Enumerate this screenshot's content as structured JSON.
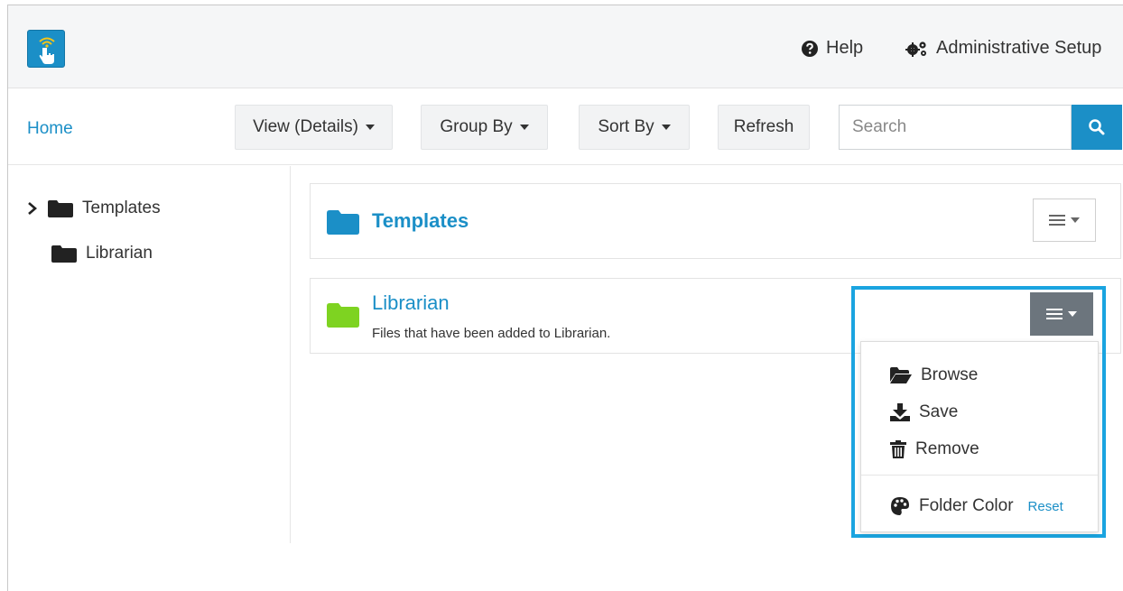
{
  "header": {
    "help_label": "Help",
    "admin_label": "Administrative Setup"
  },
  "toolbar": {
    "home_label": "Home",
    "view_label": "View (Details)",
    "group_label": "Group By",
    "sort_label": "Sort By",
    "refresh_label": "Refresh",
    "search_placeholder": "Search"
  },
  "sidebar": {
    "items": [
      {
        "label": "Templates",
        "expandable": true
      },
      {
        "label": "Librarian",
        "expandable": false
      }
    ]
  },
  "folders": [
    {
      "title": "Templates",
      "description": "",
      "color": "#1b8fc7"
    },
    {
      "title": "Librarian",
      "description": "Files that have been added to Librarian.",
      "color": "#7ed321"
    }
  ],
  "menu": {
    "browse_label": "Browse",
    "save_label": "Save",
    "remove_label": "Remove",
    "folder_color_label": "Folder Color",
    "reset_label": "Reset"
  },
  "colors": {
    "accent": "#1b8fc7",
    "highlight": "#1aa4e0",
    "librarian_folder": "#7ed321",
    "active_menu": "#6c757d"
  }
}
